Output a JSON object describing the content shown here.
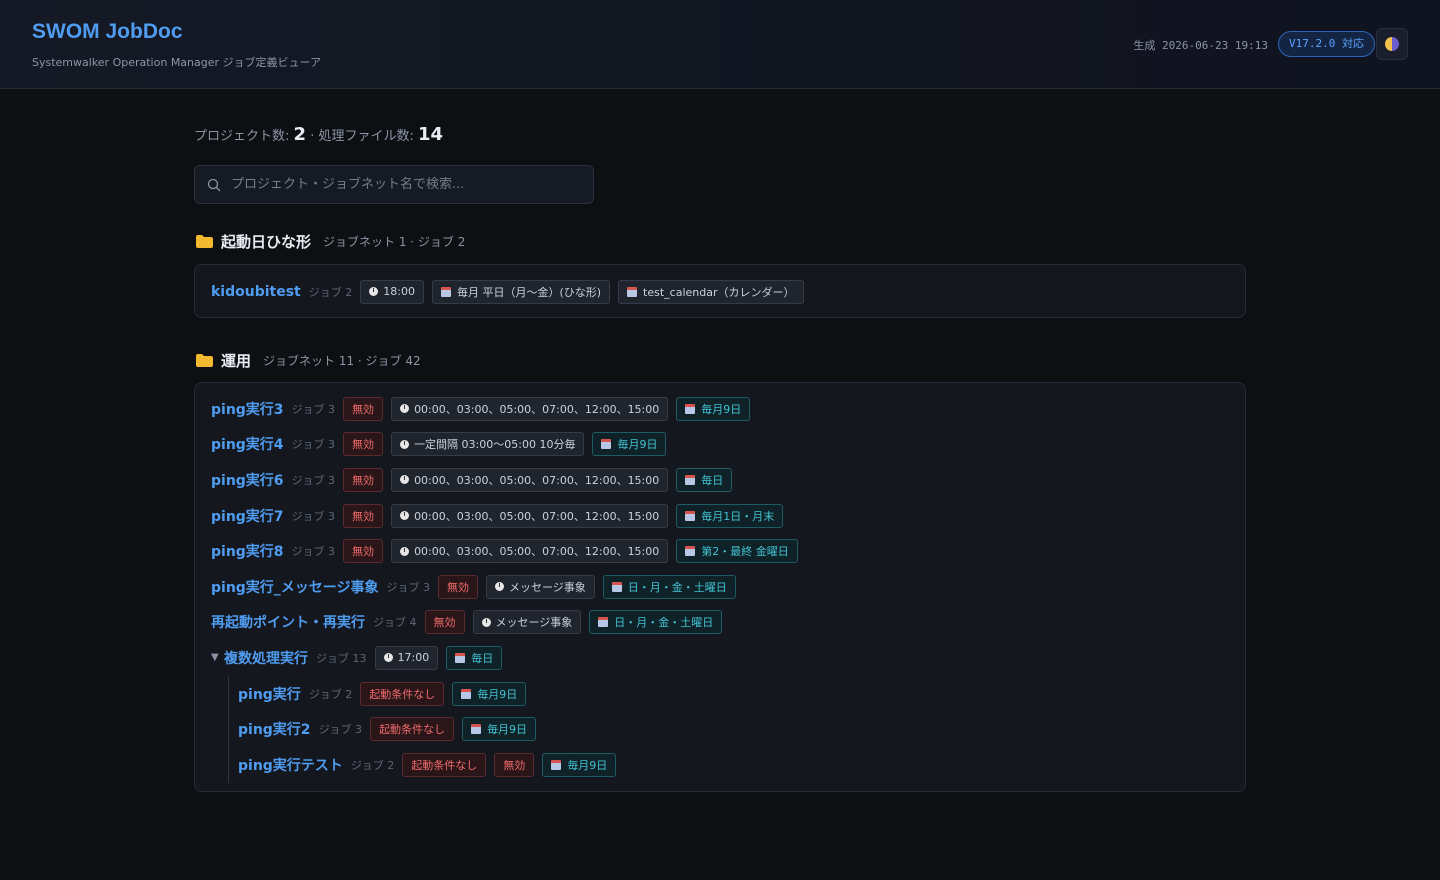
{
  "header": {
    "title": "SWOM JobDoc",
    "subtitle": "Systemwalker Operation Manager ジョブ定義ビューア",
    "generated": "生成 2026-06-23 19:13",
    "version_badge": "V17.2.0 対応"
  },
  "stats": {
    "projects_label": "プロジェクト数:",
    "projects": "2",
    "separator": "·",
    "files_label": "処理ファイル数:",
    "files": "14"
  },
  "search": {
    "placeholder": "プロジェクト・ジョブネット名で検索..."
  },
  "projects": [
    {
      "name": "起動日ひな形",
      "meta": "ジョブネット 1 · ジョブ 2",
      "jobnets": [
        {
          "name": "kidoubitest",
          "jobs": "ジョブ 2",
          "time": "18:00",
          "calendars": [
            "毎月 平日（月〜金）(ひな形)",
            "test_calendar（カレンダー）"
          ]
        }
      ]
    },
    {
      "name": "運用",
      "meta": "ジョブネット 11 · ジョブ 42",
      "jobnets": [
        {
          "name": "ping実行3",
          "jobs": "ジョブ 3",
          "status": "無効",
          "time": "00:00、03:00、05:00、07:00、12:00、15:00",
          "calendar": "毎月9日"
        },
        {
          "name": "ping実行4",
          "jobs": "ジョブ 3",
          "status": "無効",
          "time": "一定間隔 03:00〜05:00 10分毎",
          "calendar": "毎月9日"
        },
        {
          "name": "ping実行6",
          "jobs": "ジョブ 3",
          "status": "無効",
          "time": "00:00、03:00、05:00、07:00、12:00、15:00",
          "calendar": "毎日"
        },
        {
          "name": "ping実行7",
          "jobs": "ジョブ 3",
          "status": "無効",
          "time": "00:00、03:00、05:00、07:00、12:00、15:00",
          "calendar": "毎月1日・月末"
        },
        {
          "name": "ping実行8",
          "jobs": "ジョブ 3",
          "status": "無効",
          "time": "00:00、03:00、05:00、07:00、12:00、15:00",
          "calendar": "第2・最終 金曜日"
        },
        {
          "name": "ping実行_メッセージ事象",
          "jobs": "ジョブ 3",
          "status": "無効",
          "time": "メッセージ事象",
          "calendar": "日・月・金・土曜日"
        },
        {
          "name": "再起動ポイント・再実行",
          "jobs": "ジョブ 4",
          "status": "無効",
          "time": "メッセージ事象",
          "calendar": "日・月・金・土曜日"
        },
        {
          "name": "複数処理実行",
          "jobs": "ジョブ 13",
          "time": "17:00",
          "calendar": "毎日",
          "toggle": "▼",
          "children": [
            {
              "name": "ping実行",
              "jobs": "ジョブ 2",
              "status": "起動条件なし",
              "calendar": "毎月9日"
            },
            {
              "name": "ping実行2",
              "jobs": "ジョブ 3",
              "status": "起動条件なし",
              "calendar": "毎月9日"
            },
            {
              "name": "ping実行テスト",
              "jobs": "ジョブ 2",
              "status": "起動条件なし",
              "status2": "無効",
              "calendar": "毎月9日"
            }
          ]
        }
      ]
    }
  ],
  "colors": {
    "accent": "#4f9cf0",
    "background": "#0e0f13",
    "disabled": "#f06a6a",
    "calendar": "#43c2d2"
  }
}
